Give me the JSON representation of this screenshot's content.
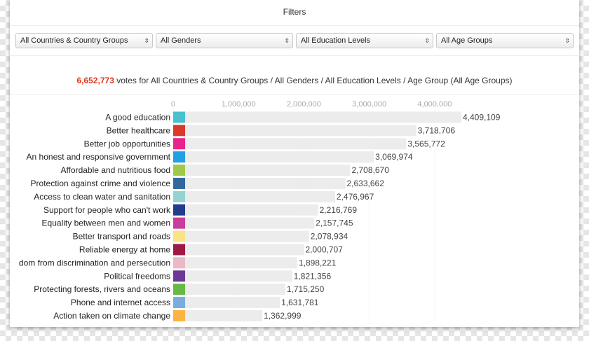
{
  "filters": {
    "title": "Filters",
    "countries": "All Countries & Country Groups",
    "genders": "All Genders",
    "education": "All Education Levels",
    "age": "All Age Groups"
  },
  "summary": {
    "total": "6,652,773",
    "text": " votes for All Countries & Country Groups / All Genders / All Education Levels / Age Group (All Age Groups)"
  },
  "chart_data": {
    "type": "bar",
    "orientation": "horizontal",
    "xlim": [
      0,
      4409109
    ],
    "ticks": [
      0,
      1000000,
      2000000,
      3000000,
      4000000
    ],
    "tick_labels": [
      "0",
      "1,000,000",
      "2,000,000",
      "3,000,000",
      "4,000,000"
    ],
    "categories": [
      "A good education",
      "Better healthcare",
      "Better job opportunities",
      "An honest and responsive government",
      "Affordable and nutritious food",
      "Protection against crime and violence",
      "Access to clean water and sanitation",
      "Support for people who can't work",
      "Equality between men and women",
      "Better transport and roads",
      "Reliable energy at home",
      "dom from discrimination and persecution",
      "Political freedoms",
      "Protecting forests, rivers and oceans",
      "Phone and internet access",
      "Action taken on climate change"
    ],
    "values": [
      4409109,
      3718706,
      3565772,
      3069974,
      2708670,
      2633662,
      2476967,
      2216769,
      2157745,
      2078934,
      2000707,
      1898221,
      1821356,
      1715250,
      1631781,
      1362999
    ],
    "value_labels": [
      "4,409,109",
      "3,718,706",
      "3,565,772",
      "3,069,974",
      "2,708,670",
      "2,633,662",
      "2,476,967",
      "2,216,769",
      "2,157,745",
      "2,078,934",
      "2,000,707",
      "1,898,221",
      "1,821,356",
      "1,715,250",
      "1,631,781",
      "1,362,999"
    ],
    "colors": [
      "#48c1cc",
      "#d93a2b",
      "#e9238c",
      "#22a0e2",
      "#9fca49",
      "#30699c",
      "#95d2d0",
      "#243c8c",
      "#c93d9b",
      "#fbe285",
      "#9e1943",
      "#e9b9c8",
      "#6e3996",
      "#67b947",
      "#79ade0",
      "#fbb344"
    ],
    "bar_color": "#ececec",
    "grid": true
  }
}
